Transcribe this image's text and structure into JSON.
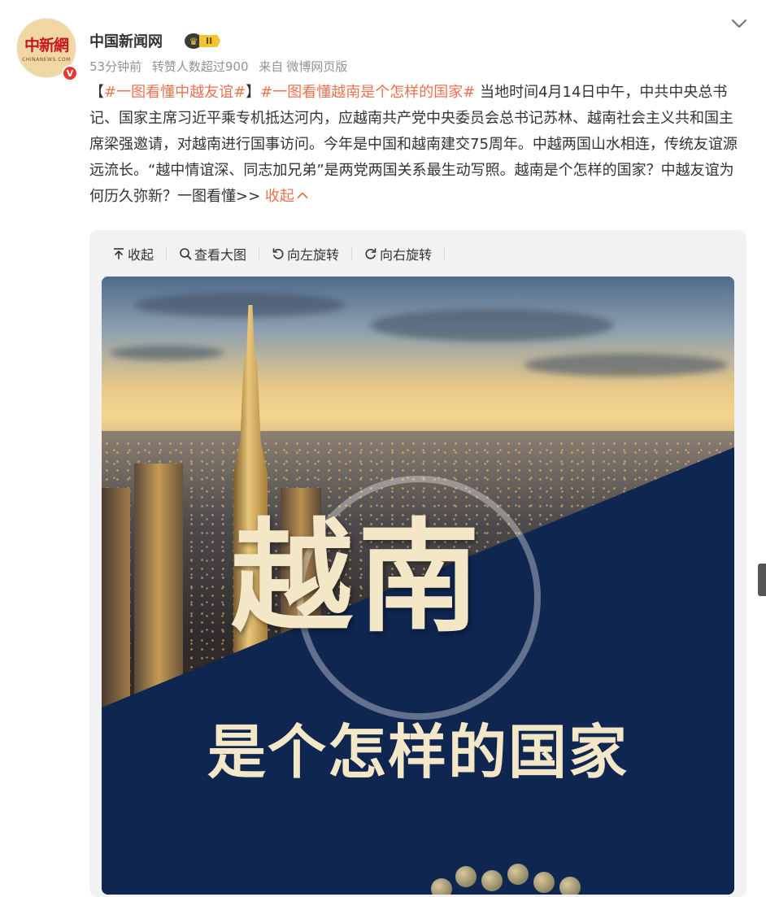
{
  "post": {
    "avatar": {
      "logo_text": "中新網",
      "sub_text": "CHINANEWS.COM",
      "verified_mark": "V"
    },
    "username": "中国新闻网",
    "vip_level": "II",
    "meta": {
      "time": "53分钟前",
      "reposts": "转赞人数超过900",
      "source_prefix": "来自",
      "source": "微博网页版"
    },
    "text": {
      "bracket_open": "【",
      "topic1": "#一图看懂中越友谊#",
      "bracket_close": "】",
      "topic2": "#一图看懂越南是个怎样的国家#",
      "body": " 当地时间4月14日中午，中共中央总书记、国家主席习近平乘专机抵达河内，应越南共产党中央委员会总书记苏林、越南社会主义共和国主席梁强邀请，对越南进行国事访问。今年是中国和越南建交75周年。中越两国山水相连，传统友谊源远流长。“越中情谊深、同志加兄弟”是两党两国关系最生动写照。越南是个怎样的国家？中越友谊为何历久弥新？一图看懂>> ",
      "collapse_label": "收起"
    },
    "media_toolbar": {
      "collapse": "收起",
      "view_large": "查看大图",
      "rotate_left": "向左旋转",
      "rotate_right": "向右旋转"
    },
    "image": {
      "title_main": "越南",
      "title_sub": "是个怎样的国家"
    }
  },
  "colors": {
    "topic": "#eb7350",
    "meta": "#939393",
    "panel_blue": "#0f2650",
    "title_cream": "#f3e7c7"
  },
  "icons": [
    "chevron-down-icon",
    "collapse-icon",
    "search-icon",
    "rotate-left-icon",
    "rotate-right-icon",
    "vip-crown-icon"
  ]
}
